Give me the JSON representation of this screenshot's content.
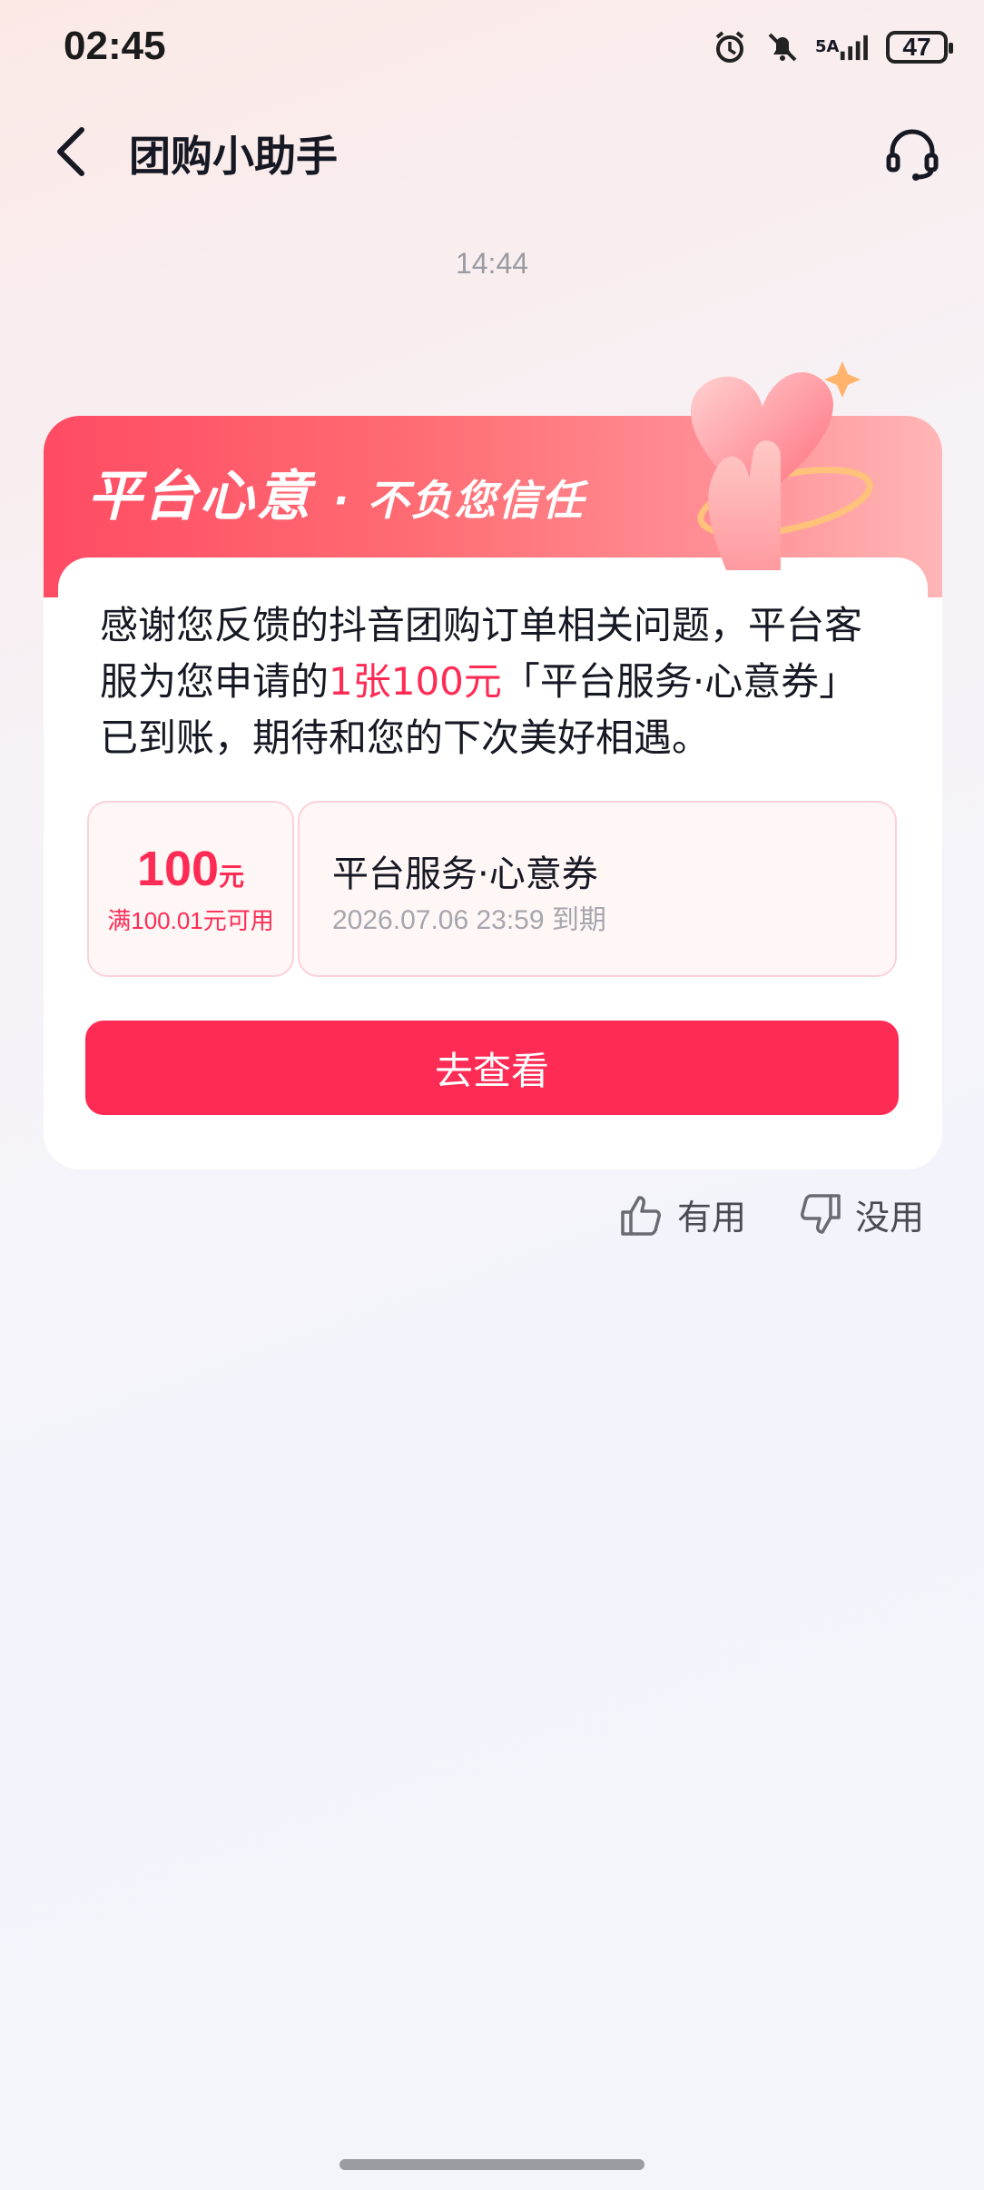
{
  "status_bar": {
    "time": "02:45",
    "network": "5A",
    "battery": "47"
  },
  "header": {
    "title": "团购小助手"
  },
  "message_time": "14:44",
  "card": {
    "banner_title": "平台心意",
    "banner_subtitle": "· 不负您信任",
    "body_part1": "感谢您反馈的抖音团购订单相关问题，平台客服为您申请的",
    "body_highlight": "1张100元",
    "body_part2": "「平台服务·心意券」已到账，期待和您的下次美好相遇。",
    "coupon": {
      "amount": "100",
      "unit": "元",
      "threshold": "满100.01元可用",
      "name": "平台服务·心意券",
      "expiry": "2026.07.06 23:59 到期"
    },
    "button_label": "去查看"
  },
  "feedback": {
    "useful": "有用",
    "useless": "没用"
  },
  "colors": {
    "accent": "#fe2c55",
    "banner_start": "#ff4b64",
    "banner_end": "#ffb6b6"
  },
  "icons": [
    "alarm-icon",
    "mute-icon",
    "signal-icon",
    "battery-icon",
    "back-icon",
    "headset-icon",
    "heart-decoration-icon",
    "thumb-up-icon",
    "thumb-down-icon"
  ]
}
